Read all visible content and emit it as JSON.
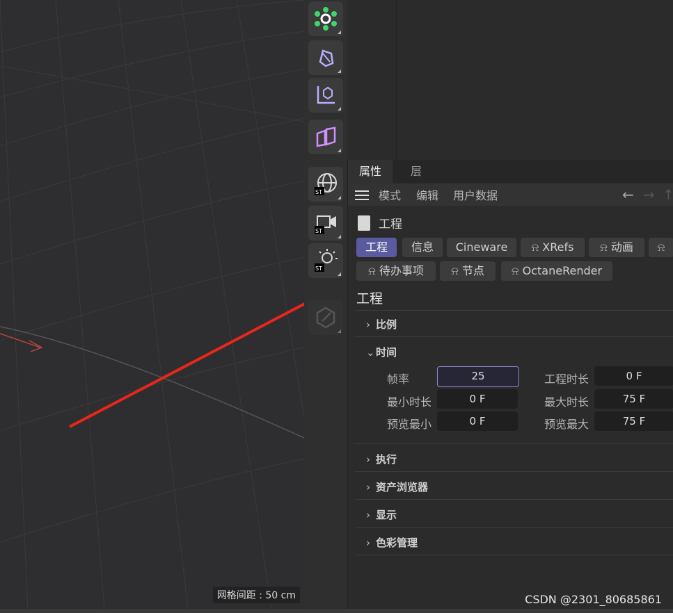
{
  "viewport": {
    "grid_spacing_label": "网格间距 : 50 cm"
  },
  "toolbar": {
    "icons": [
      "gear-icon",
      "spline-pen-icon",
      "coordinate-axis-icon",
      "deformer-icon",
      "st-globe-icon",
      "st-camera-icon",
      "st-light-icon",
      "disabled-edit-icon"
    ]
  },
  "attributes": {
    "tabs": [
      "属性",
      "层"
    ],
    "menu": [
      "模式",
      "编辑",
      "用户数据"
    ],
    "object_name": "工程",
    "buttons_row1": [
      "工程",
      "信息",
      "Cineware",
      "XRefs",
      "动画"
    ],
    "buttons_row2": [
      "待办事项",
      "节点",
      "OctaneRender"
    ],
    "section_title": "工程",
    "groups": {
      "scale": "比例",
      "time": "时间",
      "execute": "执行",
      "asset_browser": "资产浏览器",
      "display": "显示",
      "color_mgmt": "色彩管理"
    },
    "time_fields": {
      "fps_label": "帧率",
      "fps_value": "25",
      "project_len_label": "工程时长",
      "project_len_value": "0 F",
      "min_len_label": "最小时长",
      "min_len_value": "0 F",
      "max_len_label": "最大时长",
      "max_len_value": "75 F",
      "preview_min_label": "预览最小",
      "preview_min_value": "0 F",
      "preview_max_label": "预览最大",
      "preview_max_value": "75 F"
    }
  },
  "watermark": "CSDN @2301_80685861",
  "colors": {
    "accent": "#5a5aa0",
    "annotation_arrow": "#e8261c"
  }
}
